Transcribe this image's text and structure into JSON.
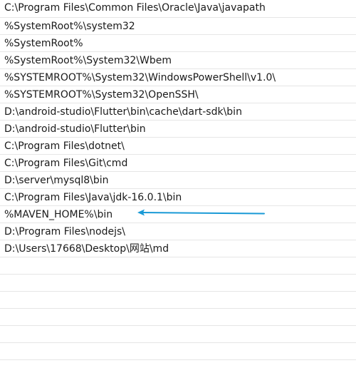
{
  "path_entries": [
    "C:\\Program Files\\Common Files\\Oracle\\Java\\javapath",
    "%SystemRoot%\\system32",
    "%SystemRoot%",
    "%SystemRoot%\\System32\\Wbem",
    "%SYSTEMROOT%\\System32\\WindowsPowerShell\\v1.0\\",
    "%SYSTEMROOT%\\System32\\OpenSSH\\",
    "D:\\android-studio\\Flutter\\bin\\cache\\dart-sdk\\bin",
    "D:\\android-studio\\Flutter\\bin",
    "C:\\Program Files\\dotnet\\",
    "C:\\Program Files\\Git\\cmd",
    "D:\\server\\mysql8\\bin",
    "C:\\Program Files\\Java\\jdk-16.0.1\\bin",
    "%MAVEN_HOME%\\bin",
    "D:\\Program Files\\nodejs\\",
    "D:\\Users\\17668\\Desktop\\网站\\md",
    "",
    "",
    "",
    "",
    "",
    ""
  ],
  "annotation": {
    "color": "#1a9ad6",
    "icon": "arrow-left-icon"
  }
}
